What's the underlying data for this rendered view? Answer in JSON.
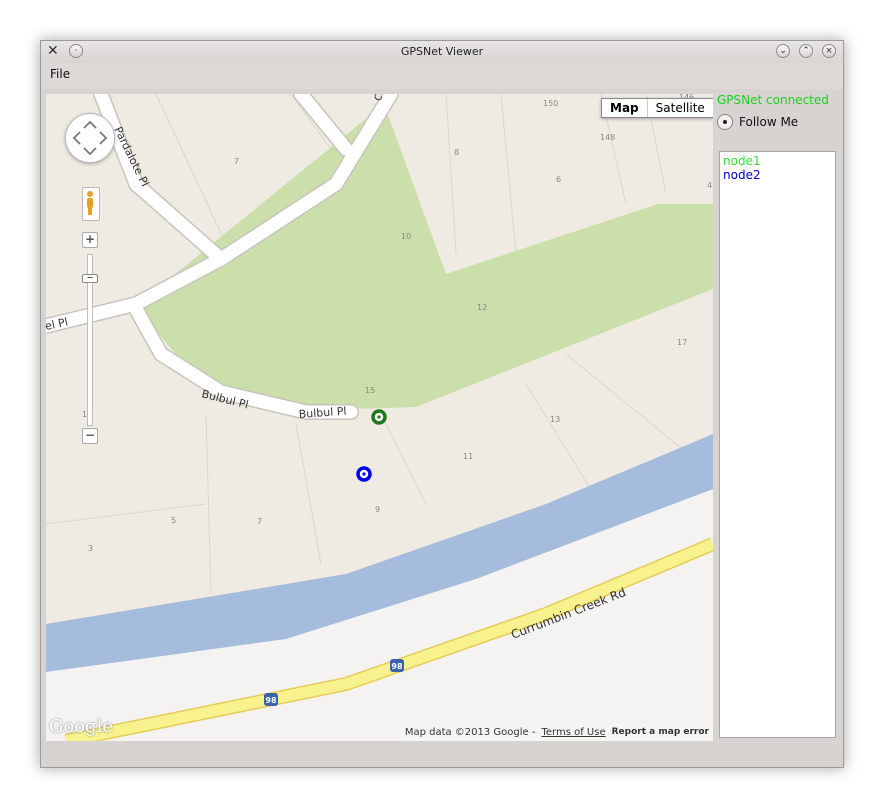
{
  "window": {
    "title": "GPSNet Viewer"
  },
  "menu": {
    "file": "File"
  },
  "map": {
    "type_buttons": {
      "map": "Map",
      "satellite": "Satellite"
    },
    "attribution": {
      "data": "Map data ©2013 Google -",
      "terms": "Terms of Use",
      "report": "Report a map error"
    },
    "logo": "Google",
    "labels": {
      "road1": "Bulbul Pl",
      "road2": "Bulbul Pl",
      "road3": "Pardalote Pl",
      "road4": "el Pl",
      "road5": "Currumbin Creek Rd",
      "road6": "C",
      "hw1": "98",
      "hw2": "98",
      "n150": "150",
      "n148": "148",
      "n146": "146",
      "n8": "8",
      "n6": "6",
      "n4": "4",
      "n7a": "7",
      "n10": "10",
      "n12": "12",
      "n17": "17",
      "n15": "15",
      "n13": "13",
      "n11": "11",
      "n9": "9",
      "n7b": "7",
      "n5": "5",
      "n3": "3",
      "n1": "1"
    }
  },
  "sidebar": {
    "status": "GPSNet connected",
    "follow_label": "Follow Me",
    "nodes": [
      {
        "name": "node1",
        "color": "#33dd33"
      },
      {
        "name": "node2",
        "color": "#0000cc"
      }
    ]
  },
  "colors": {
    "status": "#20d020",
    "marker1": "#1a7a1a",
    "marker2": "#0000ee",
    "park": "#cbdfaa",
    "river": "#a6bcdc",
    "road_yellow": "#f8f28e"
  }
}
